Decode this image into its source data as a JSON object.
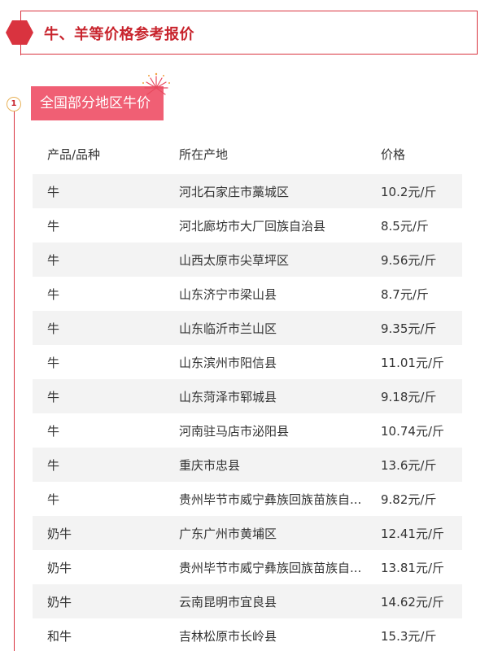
{
  "header": {
    "title": "牛、羊等价格参考报价"
  },
  "section": {
    "number": "1",
    "title": "全国部分地区牛价"
  },
  "table": {
    "columns": [
      "产品/品种",
      "所在产地",
      "价格"
    ],
    "rows": [
      [
        "牛",
        "河北石家庄市藁城区",
        "10.2元/斤"
      ],
      [
        "牛",
        "河北廊坊市大厂回族自治县",
        "8.5元/斤"
      ],
      [
        "牛",
        "山西太原市尖草坪区",
        "9.56元/斤"
      ],
      [
        "牛",
        "山东济宁市梁山县",
        "8.7元/斤"
      ],
      [
        "牛",
        "山东临沂市兰山区",
        "9.35元/斤"
      ],
      [
        "牛",
        "山东滨州市阳信县",
        "11.01元/斤"
      ],
      [
        "牛",
        "山东菏泽市郓城县",
        "9.18元/斤"
      ],
      [
        "牛",
        "河南驻马店市泌阳县",
        "10.74元/斤"
      ],
      [
        "牛",
        "重庆市忠县",
        "13.6元/斤"
      ],
      [
        "牛",
        "贵州毕节市威宁彝族回族苗族自...",
        "9.82元/斤"
      ],
      [
        "奶牛",
        "广东广州市黄埔区",
        "12.41元/斤"
      ],
      [
        "奶牛",
        "贵州毕节市威宁彝族回族苗族自...",
        "13.81元/斤"
      ],
      [
        "奶牛",
        "云南昆明市宜良县",
        "14.62元/斤"
      ],
      [
        "和牛",
        "吉林松原市长岭县",
        "15.3元/斤"
      ]
    ]
  },
  "colors": {
    "accent_red": "#c8232c",
    "tag_pink": "#f05f74",
    "row_shade": "#f3f3f3"
  }
}
